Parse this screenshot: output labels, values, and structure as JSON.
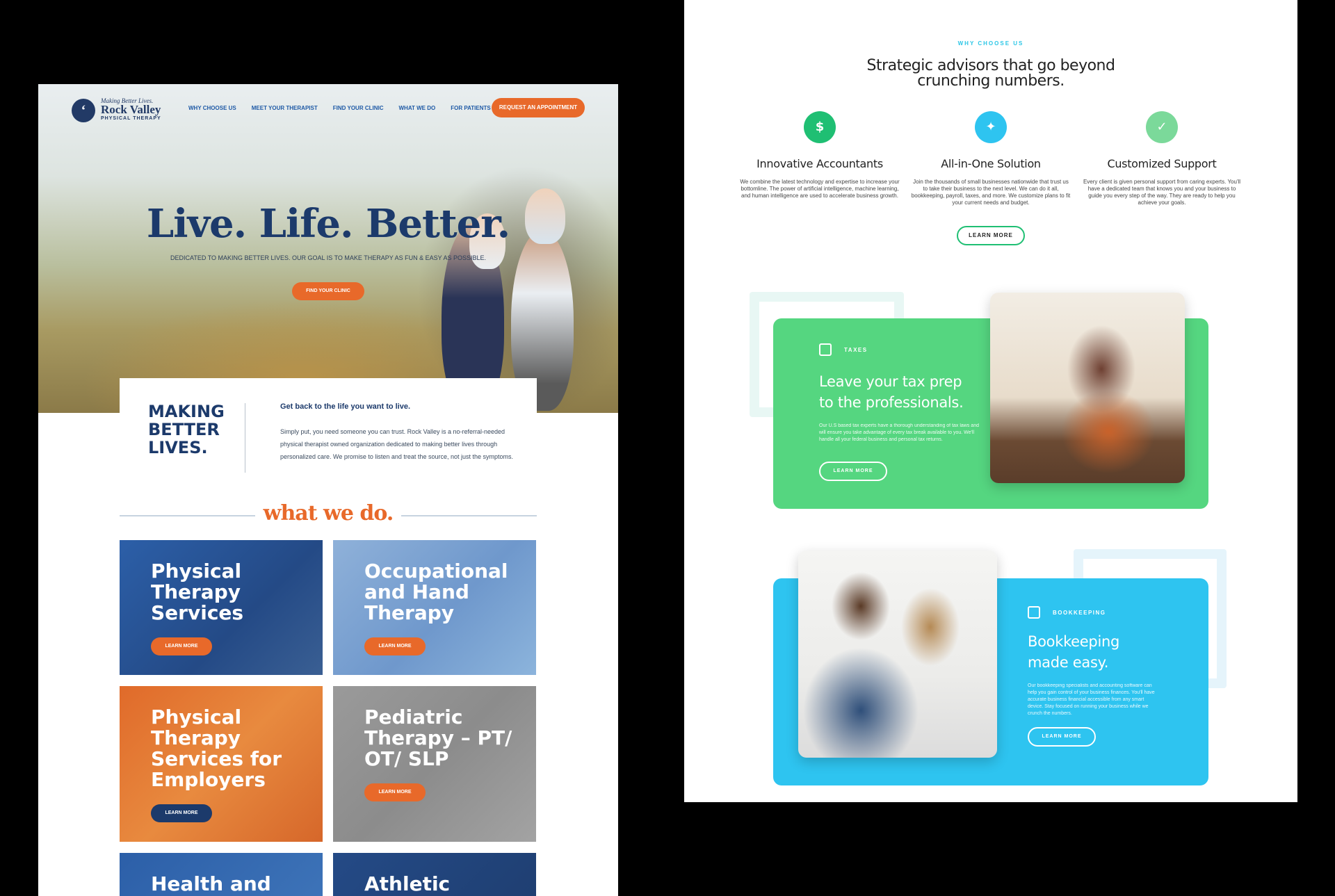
{
  "rockvalley": {
    "logo": {
      "tagline": "Making Better Lives.",
      "name": "Rock Valley",
      "sub": "PHYSICAL THERAPY",
      "mark": "‘"
    },
    "nav": [
      "WHY CHOOSE US",
      "MEET YOUR THERAPIST",
      "FIND YOUR CLINIC",
      "WHAT WE DO",
      "FOR PATIENTS"
    ],
    "nav_cta": "REQUEST AN APPOINTMENT",
    "hero": {
      "title": "Live. Life. Better.",
      "subtitle": "DEDICATED TO MAKING BETTER LIVES. OUR GOAL IS TO MAKE THERAPY AS FUN & EASY AS POSSIBLE.",
      "button": "FIND YOUR CLINIC"
    },
    "intro": {
      "heading": "MAKING BETTER LIVES.",
      "lead": "Get back to the life you want to live.",
      "body": "Simply put, you need someone you can trust. Rock Valley is a no-referral-needed physical therapist owned organization dedicated to making better lives through personalized care. We promise to listen and treat the source, not just the symptoms."
    },
    "what_we_do": "what we do.",
    "cards": [
      {
        "title": "Physical Therapy Services",
        "button": "LEARN MORE"
      },
      {
        "title": "Occupational and Hand Therapy",
        "button": "LEARN MORE"
      },
      {
        "title": "Physical Therapy Services for Employers",
        "button": "LEARN MORE"
      },
      {
        "title": "Pediatric Therapy – PT/ OT/ SLP",
        "button": "LEARN MORE"
      },
      {
        "title": "Health and"
      },
      {
        "title": "Athletic"
      }
    ],
    "colors": {
      "navy": "#1c3a6b",
      "orange": "#e8692a",
      "blue": "#1f5aa6"
    }
  },
  "accounting": {
    "eyebrow": "WHY CHOOSE US",
    "headline": [
      "Strategic advisors that go beyond",
      "crunching numbers."
    ],
    "features": [
      {
        "icon": "dollar-icon",
        "glyph": "$",
        "title": "Innovative Accountants",
        "body": "We combine the latest technology and expertise to increase your bottomline. The power of artificial intelligence, machine learning, and human intelligence are used to accelerate business growth."
      },
      {
        "icon": "handshake-icon",
        "glyph": "✦",
        "title": "All-in-One Solution",
        "body": "Join the thousands of small businesses nationwide that trust us to take their business to the next level. We can do it all, bookkeeping, payroll, taxes, and more. We customize plans to fit your current needs and budget."
      },
      {
        "icon": "shield-icon",
        "glyph": "✓",
        "title": "Customized Support",
        "body": "Every client is given personal support from caring experts. You'll have a dedicated team that knows you and your business to guide you every step of the way. They are ready to help you achieve your goals."
      }
    ],
    "learn_more": "LEARN MORE",
    "taxes": {
      "tag": "TAXES",
      "title": [
        "Leave your tax prep",
        "to the professionals."
      ],
      "body": "Our U.S based tax experts have a thorough understanding of tax laws and will ensure you take advantage of every tax break available to you. We'll handle all your federal business and personal tax returns.",
      "button": "LEARN MORE"
    },
    "bookkeeping": {
      "tag": "BOOKKEEPING",
      "title": [
        "Bookkeeping",
        "made easy."
      ],
      "body": "Our bookkeeping specialists and accounting software can help you gain control of your business finances. You'll have accurate business financial accessible from any smart device. Stay focused on running your business while we crunch the numbers.",
      "button": "LEARN MORE"
    },
    "colors": {
      "green": "#55d680",
      "teal": "#1fbf73",
      "sky": "#2ec4f0"
    }
  }
}
